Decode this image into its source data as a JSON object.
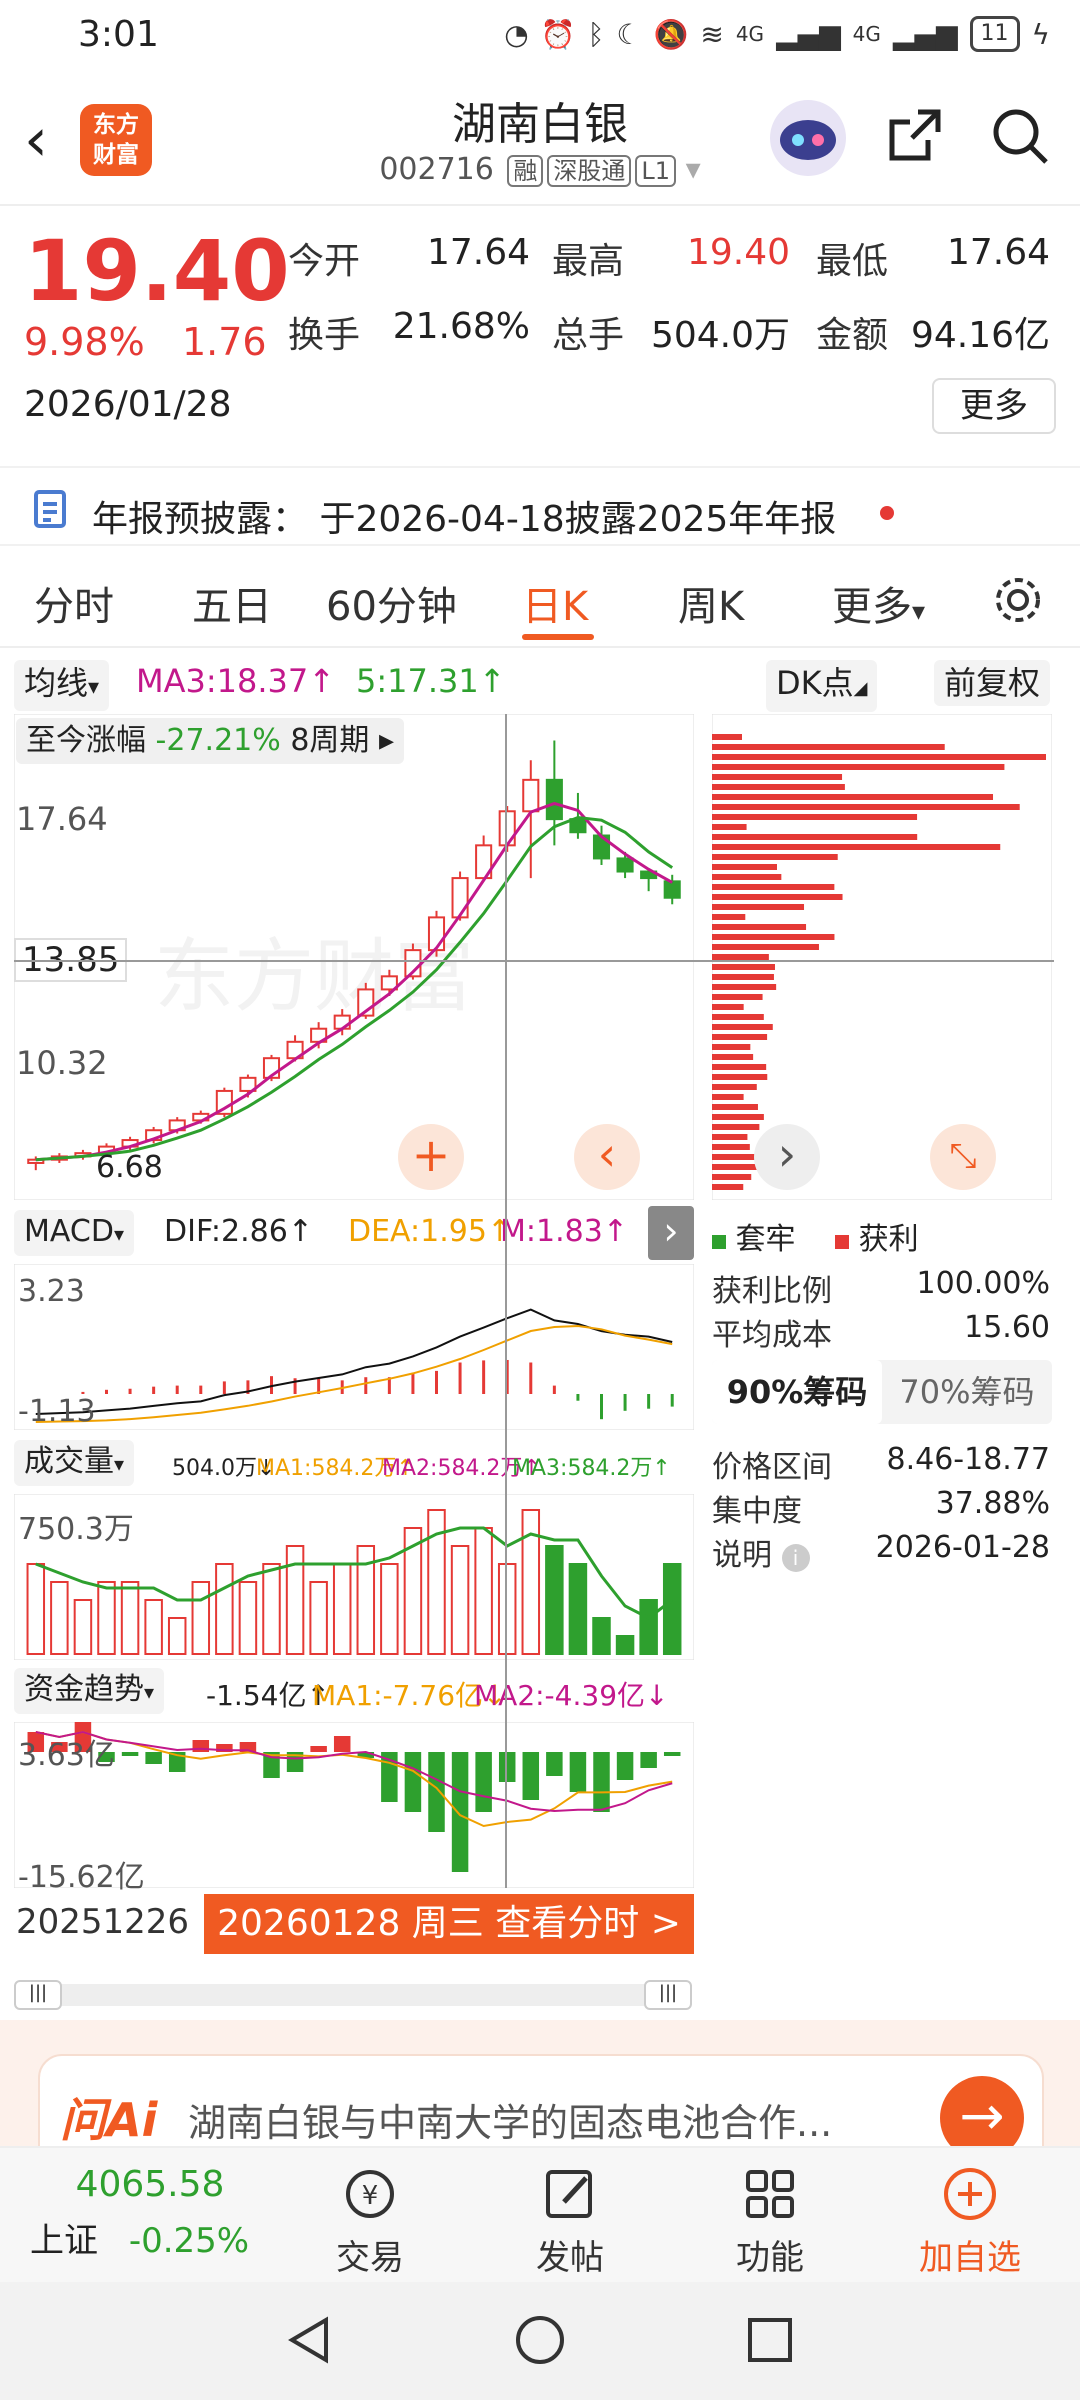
{
  "status_bar": {
    "time": "3:01",
    "battery": "11",
    "signal1": "4G",
    "signal2": "4G"
  },
  "header": {
    "back_icon": "chevron-left-icon",
    "logo_text_line1": "东方",
    "logo_text_line2": "财富",
    "stock_name": "湖南白银",
    "stock_code": "002716",
    "tags": [
      "融",
      "深股通",
      "L1"
    ]
  },
  "quote": {
    "price": "19.40",
    "change_pct": "9.98%",
    "change": "1.76",
    "date": "2026/01/28",
    "open_label": "今开",
    "open": "17.64",
    "high_label": "最高",
    "high": "19.40",
    "low_label": "最低",
    "low": "17.64",
    "turnover_label": "换手",
    "turnover": "21.68%",
    "volume_label": "总手",
    "volume": "504.0万",
    "amount_label": "金额",
    "amount": "94.16亿",
    "more_label": "更多"
  },
  "notice": {
    "text": "年报预披露：  于2026-04-18披露2025年年报"
  },
  "tabs": [
    "分时",
    "五日",
    "60分钟",
    "日K",
    "周K",
    "更多"
  ],
  "active_tab": "日K",
  "kline": {
    "ma_selector": "均线",
    "ma3": "MA3:18.37↑",
    "ma5": "5:17.31↑",
    "dk_label": "DK点",
    "fq_label": "前复权",
    "range_label": "至今涨幅",
    "range_value": "-27.21%",
    "range_period": "8周期",
    "y_labels": [
      "17.64",
      "10.32"
    ],
    "crosshair_price": "13.85",
    "low_mark": "6.68",
    "watermark": "东方财富"
  },
  "macd": {
    "selector": "MACD",
    "dif": "DIF:2.86↑",
    "dea": "DEA:1.95↑",
    "m": "M:1.83↑",
    "y_top": "3.23",
    "y_bottom": "-1.13"
  },
  "volume": {
    "selector": "成交量",
    "current": "504.0万↓",
    "ma1": "MA1:584.2万↑",
    "ma2": "MA2:584.2万↑",
    "ma3": "MA3:584.2万↑",
    "y_top": "750.3万"
  },
  "fund": {
    "selector": "资金趋势",
    "current": "-1.54亿↑",
    "ma1": "MA1:-7.76亿↓",
    "ma2": "MA2:-4.39亿↓",
    "y_top": "3.63亿",
    "y_bottom": "-15.62亿"
  },
  "time_axis": {
    "start": "20251226",
    "cursor": "20260128 周三 查看分时 >"
  },
  "chips": {
    "legend_trap": "套牢",
    "legend_profit": "获利",
    "profit_ratio_label": "获利比例",
    "profit_ratio": "100.00%",
    "avg_cost_label": "平均成本",
    "avg_cost": "15.60",
    "tab90": "90%筹码",
    "tab70": "70%筹码",
    "price_range_label": "价格区间",
    "price_range": "8.46-18.77",
    "concentration_label": "集中度",
    "concentration": "37.88%",
    "note_label": "说明",
    "note": "2026-01-28"
  },
  "ai": {
    "logo": "问Ai",
    "text": "湖南白银与中南大学的固态电池合作..."
  },
  "bottom_bar": {
    "index_value": "4065.58",
    "index_name": "上证",
    "index_change": "-0.25%",
    "trade": "交易",
    "post": "发帖",
    "functions": "功能",
    "add": "加自选"
  },
  "colors": {
    "accent": "#f05a22",
    "up": "#e53935",
    "down": "#2ea02e",
    "ma3": "#c2188b",
    "ma5": "#2ea02e"
  },
  "chart_data": {
    "type": "candlestick",
    "title": "",
    "candles": [
      {
        "o": 6.9,
        "h": 7.1,
        "l": 6.68,
        "c": 7.0
      },
      {
        "o": 7.0,
        "h": 7.2,
        "l": 6.9,
        "c": 7.1
      },
      {
        "o": 7.1,
        "h": 7.3,
        "l": 7.0,
        "c": 7.2
      },
      {
        "o": 7.2,
        "h": 7.5,
        "l": 7.1,
        "c": 7.4
      },
      {
        "o": 7.4,
        "h": 7.7,
        "l": 7.3,
        "c": 7.6
      },
      {
        "o": 7.6,
        "h": 8.0,
        "l": 7.5,
        "c": 7.9
      },
      {
        "o": 7.9,
        "h": 8.3,
        "l": 7.8,
        "c": 8.2
      },
      {
        "o": 8.2,
        "h": 8.5,
        "l": 8.1,
        "c": 8.4
      },
      {
        "o": 8.4,
        "h": 9.2,
        "l": 8.3,
        "c": 9.1
      },
      {
        "o": 9.1,
        "h": 9.6,
        "l": 8.9,
        "c": 9.5
      },
      {
        "o": 9.5,
        "h": 10.2,
        "l": 9.4,
        "c": 10.1
      },
      {
        "o": 10.1,
        "h": 10.8,
        "l": 10.0,
        "c": 10.6
      },
      {
        "o": 10.6,
        "h": 11.2,
        "l": 10.4,
        "c": 11.0
      },
      {
        "o": 11.0,
        "h": 11.6,
        "l": 10.8,
        "c": 11.4
      },
      {
        "o": 11.4,
        "h": 12.4,
        "l": 11.3,
        "c": 12.2
      },
      {
        "o": 12.2,
        "h": 12.8,
        "l": 12.0,
        "c": 12.6
      },
      {
        "o": 12.6,
        "h": 13.6,
        "l": 12.5,
        "c": 13.4
      },
      {
        "o": 13.4,
        "h": 14.6,
        "l": 13.2,
        "c": 14.4
      },
      {
        "o": 14.4,
        "h": 15.8,
        "l": 14.3,
        "c": 15.6
      },
      {
        "o": 15.6,
        "h": 16.9,
        "l": 15.5,
        "c": 16.6
      },
      {
        "o": 16.6,
        "h": 17.8,
        "l": 16.4,
        "c": 17.64
      },
      {
        "o": 17.64,
        "h": 19.2,
        "l": 15.6,
        "c": 18.6
      },
      {
        "o": 18.6,
        "h": 19.8,
        "l": 16.6,
        "c": 17.4
      },
      {
        "o": 17.4,
        "h": 18.2,
        "l": 16.8,
        "c": 17.0
      },
      {
        "o": 16.9,
        "h": 17.2,
        "l": 16.0,
        "c": 16.2
      },
      {
        "o": 16.2,
        "h": 16.4,
        "l": 15.6,
        "c": 15.8
      },
      {
        "o": 15.8,
        "h": 15.9,
        "l": 15.2,
        "c": 15.6
      },
      {
        "o": 15.5,
        "h": 15.7,
        "l": 14.8,
        "c": 15.0
      }
    ],
    "ymin": 6.68,
    "ymax": 19.4
  }
}
